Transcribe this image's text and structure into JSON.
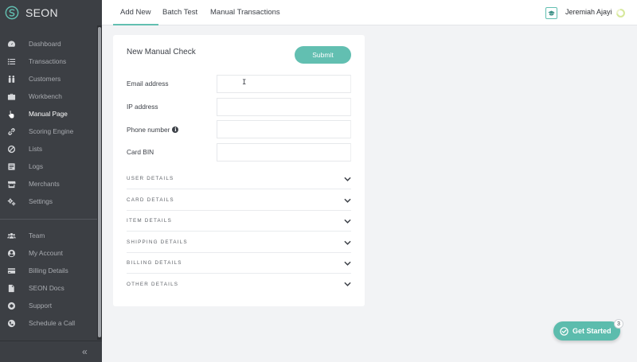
{
  "app": {
    "name": "SEON"
  },
  "sidebar": {
    "primary": [
      {
        "label": "Dashboard",
        "icon": "dashboard-icon"
      },
      {
        "label": "Transactions",
        "icon": "list-icon"
      },
      {
        "label": "Customers",
        "icon": "customers-icon"
      },
      {
        "label": "Workbench",
        "icon": "briefcase-icon"
      },
      {
        "label": "Manual Page",
        "icon": "hand-pointer-icon",
        "active": true
      },
      {
        "label": "Scoring Engine",
        "icon": "link-icon"
      },
      {
        "label": "Lists",
        "icon": "ban-icon"
      },
      {
        "label": "Logs",
        "icon": "logs-icon"
      },
      {
        "label": "Merchants",
        "icon": "store-icon"
      },
      {
        "label": "Settings",
        "icon": "gears-icon"
      }
    ],
    "secondary": [
      {
        "label": "Team",
        "icon": "team-icon"
      },
      {
        "label": "My Account",
        "icon": "account-icon"
      },
      {
        "label": "Billing Details",
        "icon": "credit-card-icon"
      },
      {
        "label": "SEON Docs",
        "icon": "document-icon"
      },
      {
        "label": "Support",
        "icon": "support-icon"
      },
      {
        "label": "Schedule a Call",
        "icon": "phone-icon"
      }
    ],
    "collapse_glyph": "«"
  },
  "topbar": {
    "tabs": [
      {
        "label": "Add New",
        "active": true
      },
      {
        "label": "Batch Test"
      },
      {
        "label": "Manual Transactions"
      }
    ],
    "user_name": "Jeremiah Ajayi"
  },
  "form": {
    "title": "New Manual Check",
    "submit_label": "Submit",
    "fields": [
      {
        "label": "Email address",
        "value": "",
        "info": false
      },
      {
        "label": "IP address",
        "value": "",
        "info": false
      },
      {
        "label": "Phone number",
        "value": "",
        "info": true
      },
      {
        "label": "Card BIN",
        "value": "",
        "info": false
      }
    ],
    "sections": [
      "USER DETAILS",
      "CARD DETAILS",
      "ITEM DETAILS",
      "SHIPPING DETAILS",
      "BILLING DETAILS",
      "OTHER DETAILS"
    ]
  },
  "get_started": {
    "label": "Get Started",
    "badge": "3"
  },
  "colors": {
    "accent": "#62bfb1",
    "sidebar": "#3c3f44",
    "background": "#f2f3f5"
  }
}
